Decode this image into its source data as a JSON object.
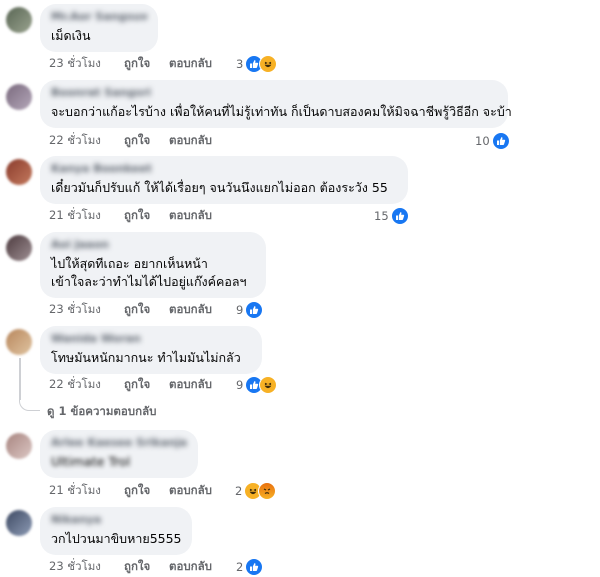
{
  "comments": [
    {
      "author": "Mr.Aor Sangsuwan",
      "text": "เม็ดเงิน",
      "time": "23 ชั่วโมง",
      "like": "ถูกใจ",
      "reply": "ตอบกลับ",
      "reaction_count": "3",
      "reactions": [
        "like-icon",
        "haha-icon"
      ],
      "avatar_colors": [
        "#596654",
        "#9aa38f"
      ]
    },
    {
      "author": "Boonrat Sangsri",
      "text": "จะบอกว่าแก้อะไรบ้าง เพื่อให้คนที่ไม่รู้เท่าทัน ก็เป็นดาบสองคมให้มิจฉาชีพรู้วิธีอีก จะบ้า",
      "time": "22 ชั่วโมง",
      "like": "ถูกใจ",
      "reply": "ตอบกลับ",
      "reaction_count": "10",
      "reactions": [
        "like-icon"
      ],
      "avatar_colors": [
        "#7a6a7e",
        "#b4a7b9"
      ]
    },
    {
      "author": "Kanya Boonkeet",
      "text": "เดี๋ยวมันก็ปรับแก้ ให้ได้เรื่อยๆ จนวันนึงแยกไม่ออก ต้องระวัง 55",
      "time": "21 ชั่วโมง",
      "like": "ถูกใจ",
      "reply": "ตอบกลับ",
      "reaction_count": "15",
      "reactions": [
        "like-icon"
      ],
      "avatar_colors": [
        "#8a3b2c",
        "#c47a5e"
      ]
    },
    {
      "author": "Aoi Jaaon",
      "text_lines": [
        "ไปให้สุดทีเถอะ อยากเห็นหน้า",
        "เข้าใจละว่าทำไมได้ไปอยู่แก๊งค์คอลฯ"
      ],
      "time": "23 ชั่วโมง",
      "like": "ถูกใจ",
      "reply": "ตอบกลับ",
      "reaction_count": "9",
      "reactions": [
        "like-icon"
      ],
      "avatar_colors": [
        "#4d3b3f",
        "#9e8f93"
      ]
    },
    {
      "author": "Wanida Woran",
      "text": "โทษมันหนักมากนะ ทำไมมันไม่กลัว",
      "time": "22 ชั่วโมง",
      "like": "ถูกใจ",
      "reply": "ตอบกลับ",
      "reaction_count": "9",
      "reactions": [
        "like-icon",
        "haha-icon"
      ],
      "avatar_colors": [
        "#b8875d",
        "#e0c4a1"
      ]
    },
    {
      "author": "Arlee Kaesee Srikanjai",
      "text": "Ultimate Trol",
      "time": "21 ชั่วโมง",
      "like": "ถูกใจ",
      "reply": "ตอบกลับ",
      "reaction_count": "2",
      "reactions": [
        "haha-icon",
        "angry-icon"
      ],
      "avatar_colors": [
        "#a88580",
        "#dcc7c4"
      ]
    },
    {
      "author": "Nikanya",
      "text": "วกไปวนมาขิบหาย5555",
      "time": "23 ชั่วโมง",
      "like": "ถูกใจ",
      "reply": "ตอบกลับ",
      "reaction_count": "2",
      "reactions": [
        "like-icon"
      ],
      "avatar_colors": [
        "#3e4a63",
        "#8d9bb5"
      ]
    }
  ],
  "view_replies": "ดู 1 ข้อความตอบกลับ"
}
